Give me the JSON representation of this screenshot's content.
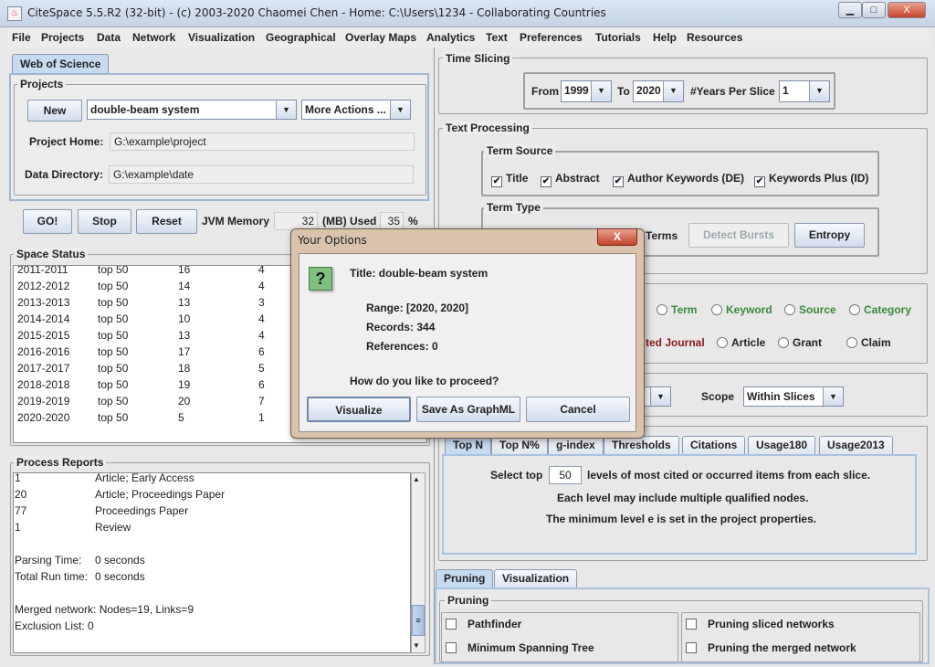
{
  "window": {
    "title": "CiteSpace 5.5.R2 (32-bit) - (c) 2003-2020 Chaomei Chen - Home: C:\\Users\\1234 - Collaborating Countries",
    "minimize": "▁",
    "maximize": "□",
    "close": "X"
  },
  "menu": [
    "File",
    "Projects",
    "Data",
    "Network",
    "Visualization",
    "Geographical",
    "Overlay Maps",
    "Analytics",
    "Text",
    "Preferences",
    "Tutorials",
    "Help",
    "Resources"
  ],
  "left": {
    "tab": "Web of Science",
    "projects_label": "Projects",
    "new_label": "New",
    "project_select": "double-beam system",
    "more_actions": "More Actions ...",
    "project_home_label": "Project Home:",
    "project_home": "G:\\example\\project",
    "data_dir_label": "Data Directory:",
    "data_dir": "G:\\example\\date",
    "go": "GO!",
    "stop": "Stop",
    "reset": "Reset",
    "jvm_label": "JVM Memory",
    "jvm_value": "32",
    "jvm_used_label": "(MB) Used",
    "jvm_pct": "35",
    "pct_sign": "%",
    "space_status_label": "Space Status",
    "space_rows": [
      [
        "2011-2011",
        "top 50",
        "16",
        "4"
      ],
      [
        "2012-2012",
        "top 50",
        "14",
        "4"
      ],
      [
        "2013-2013",
        "top 50",
        "13",
        "3"
      ],
      [
        "2014-2014",
        "top 50",
        "10",
        "4"
      ],
      [
        "2015-2015",
        "top 50",
        "13",
        "4"
      ],
      [
        "2016-2016",
        "top 50",
        "17",
        "6"
      ],
      [
        "2017-2017",
        "top 50",
        "18",
        "5"
      ],
      [
        "2018-2018",
        "top 50",
        "19",
        "6"
      ],
      [
        "2019-2019",
        "top 50",
        "20",
        "7"
      ],
      [
        "2020-2020",
        "top 50",
        "5",
        "1"
      ]
    ],
    "process_label": "Process Reports",
    "process_rows": [
      [
        "1",
        "Article; Early Access"
      ],
      [
        "20",
        "Article; Proceedings Paper"
      ],
      [
        "77",
        "Proceedings Paper"
      ],
      [
        "1",
        "Review"
      ],
      [
        "",
        ""
      ],
      [
        "Parsing Time:",
        "0 seconds"
      ],
      [
        "Total Run time:",
        "0 seconds"
      ],
      [
        "",
        ""
      ],
      [
        "Merged network: Nodes=19, Links=9",
        ""
      ],
      [
        "Exclusion List: 0",
        ""
      ]
    ]
  },
  "right": {
    "time_slicing": {
      "label": "Time Slicing",
      "from_label": "From",
      "from": "1999",
      "to_label": "To",
      "to": "2020",
      "years_label": "#Years Per Slice",
      "years": "1"
    },
    "text_processing": {
      "label": "Text Processing",
      "term_source_label": "Term Source",
      "sources": [
        {
          "label": "Title",
          "checked": true
        },
        {
          "label": "Abstract",
          "checked": true
        },
        {
          "label": "Author Keywords (DE)",
          "checked": true
        },
        {
          "label": "Keywords Plus (ID)",
          "checked": true
        }
      ],
      "term_type_label": "Term Type",
      "terms_label": "Terms",
      "detect_bursts": "Detect Bursts",
      "entropy": "Entropy"
    },
    "node_types_row1": [
      "Term",
      "Keyword",
      "Source",
      "Category"
    ],
    "node_types_row2_partial": "ted Journal",
    "node_types_row2": [
      "Article",
      "Grant",
      "Claim"
    ],
    "scope_label": "Scope",
    "scope": "Within Slices",
    "selection_tabs": [
      "Top N",
      "Top N%",
      "g-index",
      "Thresholds",
      "Citations",
      "Usage180",
      "Usage2013"
    ],
    "select_top_label": "Select top",
    "select_top": "50",
    "select_top_suffix": "levels of most cited or occurred items from each slice.",
    "info1": "Each level may include multiple qualified nodes.",
    "info2": "The minimum level e is set in the project properties.",
    "bottom_tabs": [
      "Pruning",
      "Visualization"
    ],
    "pruning_label": "Pruning",
    "pruning_options": [
      "Pathfinder",
      "Minimum Spanning Tree",
      "Pruning sliced networks",
      "Pruning the merged network"
    ]
  },
  "dialog": {
    "title": "Your Options",
    "icon": "question-icon",
    "title_line": "Title: double-beam system",
    "range": "Range: [2020, 2020]",
    "records": "Records: 344",
    "references": "References: 0",
    "question": "How do you like to proceed?",
    "visualize": "Visualize",
    "save_graphml": "Save As GraphML",
    "cancel": "Cancel",
    "close": "X"
  }
}
